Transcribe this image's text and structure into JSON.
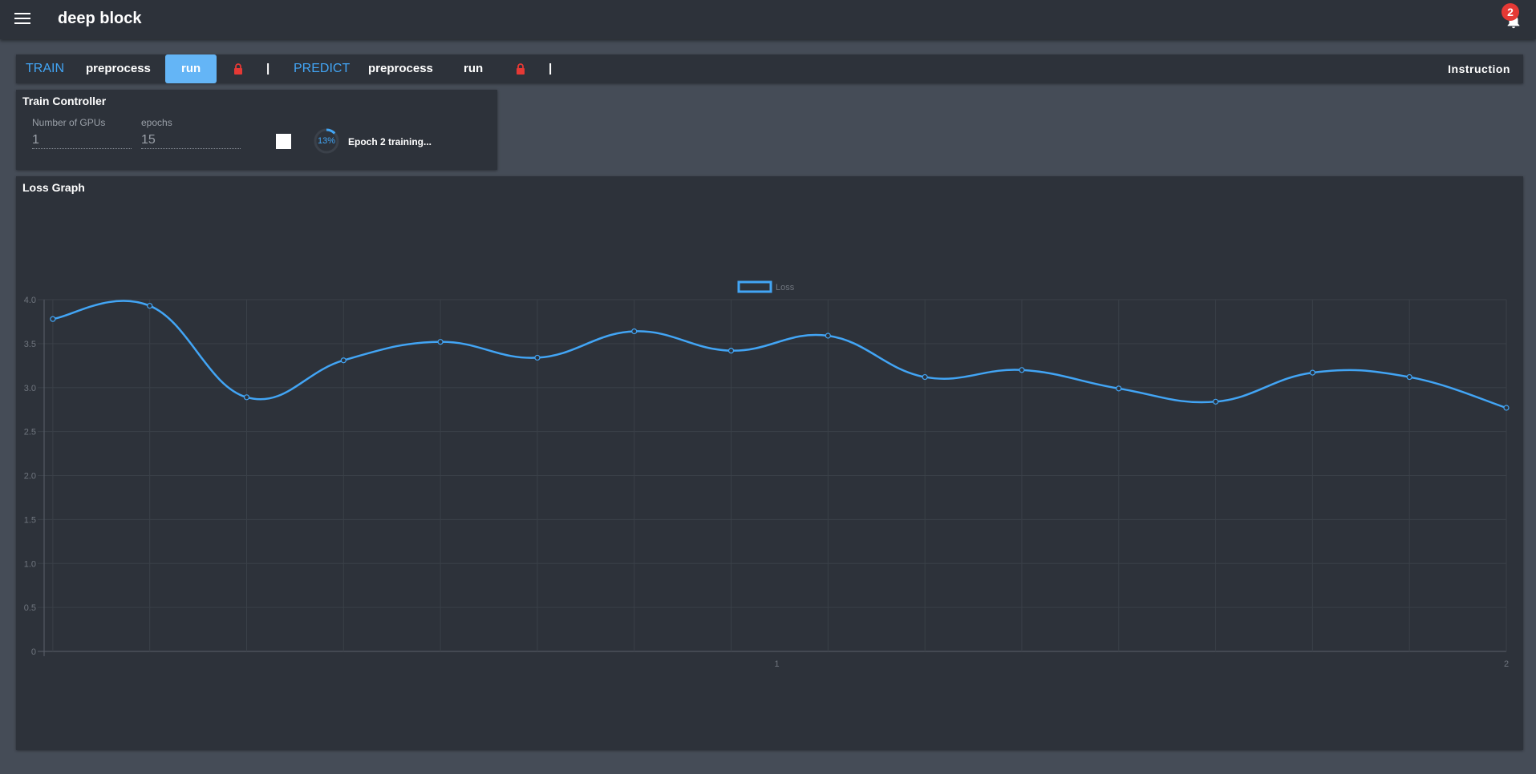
{
  "app": {
    "title": "deep block",
    "notification_count": "2"
  },
  "tabs": {
    "train_label": "TRAIN",
    "train_preprocess": "preprocess",
    "train_run": "run",
    "separator": "|",
    "predict_label": "PREDICT",
    "predict_preprocess": "preprocess",
    "predict_run": "run",
    "instruction": "Instruction"
  },
  "controller": {
    "title": "Train Controller",
    "gpus_label": "Number of GPUs",
    "gpus_value": "1",
    "epochs_label": "epochs",
    "epochs_value": "15",
    "progress_text": "13%",
    "progress_value": 0.13,
    "status": "Epoch 2 training..."
  },
  "graph": {
    "title": "Loss Graph"
  },
  "colors": {
    "accent": "#42a5f5",
    "active_tab": "#64b5f6",
    "lock": "#e53935",
    "panel": "#2d323a",
    "background": "#454c57"
  },
  "chart_data": {
    "type": "line",
    "series": [
      {
        "name": "Loss",
        "values": [
          3.78,
          3.93,
          2.89,
          3.31,
          3.52,
          3.34,
          3.64,
          3.42,
          3.59,
          3.12,
          3.2,
          2.99,
          2.84,
          3.17,
          3.12,
          2.77
        ]
      }
    ],
    "x_tick_labels": [
      "1",
      "2"
    ],
    "y_ticks": [
      "0",
      "0.5",
      "1.0",
      "1.5",
      "2.0",
      "2.5",
      "3.0",
      "3.5",
      "4.0"
    ],
    "ylim": [
      0,
      4.0
    ],
    "grid": true,
    "legend": "top-center"
  }
}
